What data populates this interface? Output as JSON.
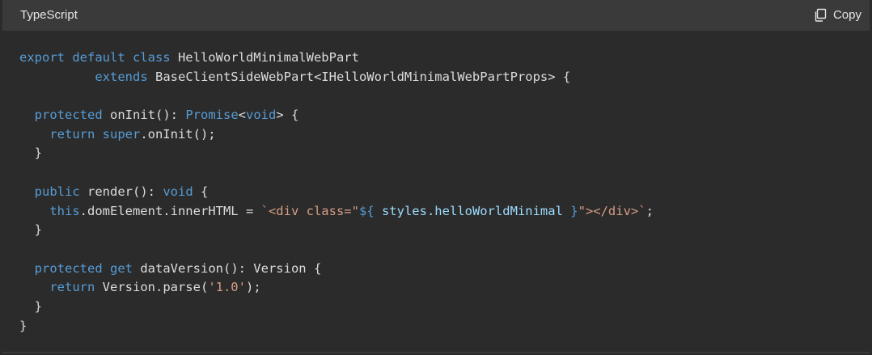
{
  "header": {
    "language": "TypeScript",
    "copy_label": "Copy"
  },
  "code": {
    "lines": [
      [
        [
          "kw",
          "export default class"
        ],
        [
          "pl",
          " HelloWorldMinimalWebPart"
        ]
      ],
      [
        [
          "pl",
          "          "
        ],
        [
          "kw",
          "extends"
        ],
        [
          "pl",
          " BaseClientSideWebPart<IHelloWorldMinimalWebPartProps> {"
        ]
      ],
      [
        [
          "pl",
          ""
        ]
      ],
      [
        [
          "pl",
          "  "
        ],
        [
          "kw",
          "protected"
        ],
        [
          "pl",
          " onInit(): "
        ],
        [
          "kw",
          "Promise"
        ],
        [
          "pl",
          "<"
        ],
        [
          "kw",
          "void"
        ],
        [
          "pl",
          "> {"
        ]
      ],
      [
        [
          "pl",
          "    "
        ],
        [
          "kw",
          "return super"
        ],
        [
          "pl",
          ".onInit();"
        ]
      ],
      [
        [
          "pl",
          "  }"
        ]
      ],
      [
        [
          "pl",
          ""
        ]
      ],
      [
        [
          "pl",
          "  "
        ],
        [
          "kw",
          "public"
        ],
        [
          "pl",
          " render(): "
        ],
        [
          "kw",
          "void"
        ],
        [
          "pl",
          " {"
        ]
      ],
      [
        [
          "pl",
          "    "
        ],
        [
          "kw",
          "this"
        ],
        [
          "pl",
          ".domElement.innerHTML = "
        ],
        [
          "str",
          "`<div class=\""
        ],
        [
          "kw",
          "${"
        ],
        [
          "id",
          " styles.helloWorldMinimal "
        ],
        [
          "kw",
          "}"
        ],
        [
          "str",
          "\"></div>`"
        ],
        [
          "pl",
          ";"
        ]
      ],
      [
        [
          "pl",
          "  }"
        ]
      ],
      [
        [
          "pl",
          ""
        ]
      ],
      [
        [
          "pl",
          "  "
        ],
        [
          "kw",
          "protected get"
        ],
        [
          "pl",
          " dataVersion(): Version {"
        ]
      ],
      [
        [
          "pl",
          "    "
        ],
        [
          "kw",
          "return"
        ],
        [
          "pl",
          " Version.parse("
        ],
        [
          "str",
          "'1.0'"
        ],
        [
          "pl",
          ");"
        ]
      ],
      [
        [
          "pl",
          "  }"
        ]
      ],
      [
        [
          "pl",
          "}"
        ]
      ]
    ]
  },
  "icons": {
    "copy": "copy-icon"
  }
}
